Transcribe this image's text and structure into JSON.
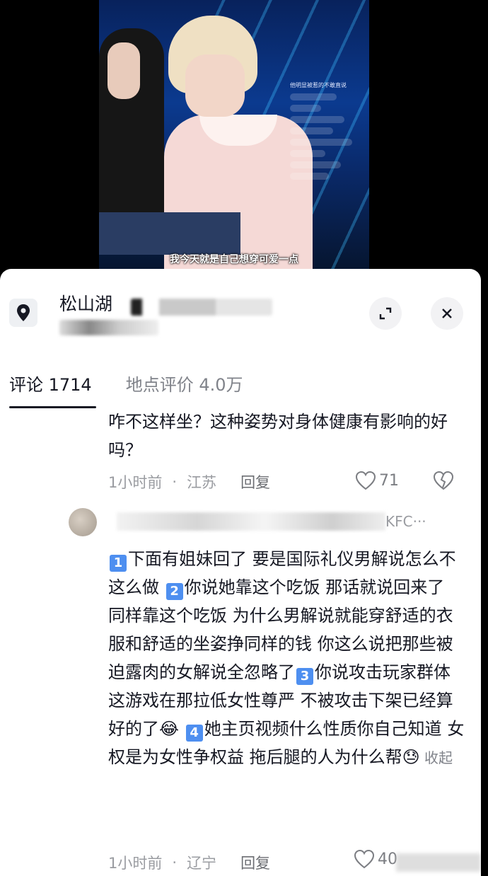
{
  "video": {
    "subtitle": "我今天就是自己想穿可爱一点",
    "overlay_title": "他明显被惹的不敢直说"
  },
  "sheet": {
    "place_name": "松山湖",
    "tabs": [
      {
        "label": "评论 1714"
      },
      {
        "label": "地点评价 4.0万"
      }
    ]
  },
  "comments": [
    {
      "text": "咋不这样坐？这种姿势对身体健康有影响的好吗？",
      "time": "1小时前",
      "region": "江苏",
      "reply_label": "回复",
      "likes": "71"
    },
    {
      "user_visible_tail": "KFC···",
      "segments": [
        {
          "type": "num",
          "v": "1"
        },
        {
          "type": "text",
          "v": "下面有姐妹回了 要是国际礼仪男解说怎么不这么做 "
        },
        {
          "type": "num",
          "v": "2"
        },
        {
          "type": "text",
          "v": "你说她靠这个吃饭 那话就说回来了 同样靠这个吃饭 为什么男解说就能穿舒适的衣服和舒适的坐姿挣同样的钱 你这么说把那些被迫露肉的女解说全忽略了"
        },
        {
          "type": "num",
          "v": "3"
        },
        {
          "type": "text",
          "v": "你说攻击玩家群体 这游戏在那拉低女性尊严 不被攻击下架已经算好的了"
        },
        {
          "type": "emoji",
          "v": "😂"
        },
        {
          "type": "text",
          "v": " "
        },
        {
          "type": "num",
          "v": "4"
        },
        {
          "type": "text",
          "v": "她主页视频什么性质你自己知道 女权是为女性争权益 拖后腿的人为什么帮"
        },
        {
          "type": "emoji",
          "v": "😓"
        },
        {
          "type": "collapse",
          "v": " 收起"
        }
      ],
      "time": "1小时前",
      "region": "辽宁",
      "reply_label": "回复",
      "likes": "40"
    }
  ],
  "colors": {
    "text_primary": "#161823",
    "text_secondary": "#9a9ca1",
    "emoji_number_bg": "#4e8ff0"
  }
}
